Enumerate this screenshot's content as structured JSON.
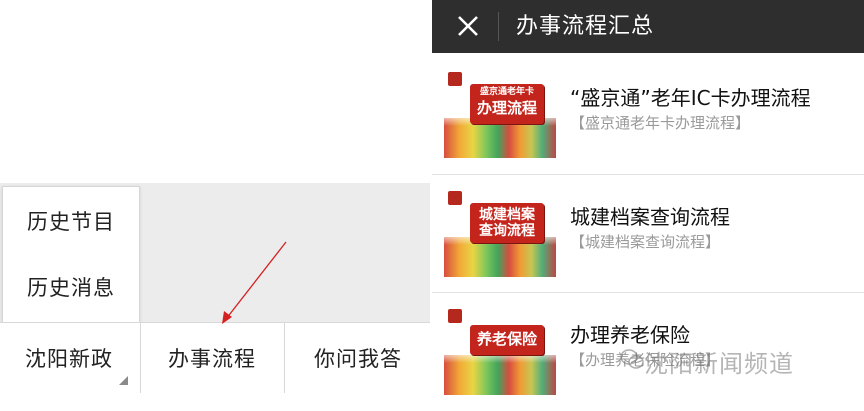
{
  "popup_menu": {
    "items": [
      "历史节目",
      "历史消息"
    ]
  },
  "bottom_menu": {
    "tabs": [
      "沈阳新政",
      "办事流程",
      "你问我答"
    ]
  },
  "panel": {
    "title": "办事流程汇总",
    "articles": [
      {
        "title": "“盛京通”老年IC卡办理流程",
        "subtitle": "【盛京通老年卡办理流程】",
        "thumb_small": "盛京通老年卡",
        "thumb_big": "办理流程"
      },
      {
        "title": "城建档案查询流程",
        "subtitle": "【城建档案查询流程】",
        "thumb_big": "城建档案\n查询流程"
      },
      {
        "title": "办理养老保险",
        "subtitle": "【办理养老保险流程】",
        "thumb_big": "养老保险"
      }
    ]
  },
  "watermark": {
    "text": "沈阳新闻频道"
  },
  "colors": {
    "title_bar": "#2e2e2e",
    "thumb_banner": "#c3241c",
    "arrow": "#d42020"
  }
}
